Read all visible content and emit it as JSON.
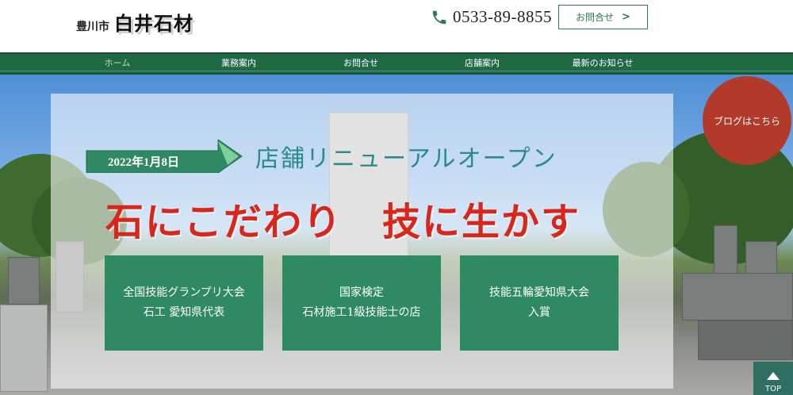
{
  "header": {
    "city": "豊川市",
    "company": "白井石材",
    "phone": "0533-89-8855",
    "contact_label": "お問合せ"
  },
  "nav": {
    "items": [
      {
        "label": "ホーム",
        "active": true
      },
      {
        "label": "業務案内"
      },
      {
        "label": "お問合せ"
      },
      {
        "label": "店舗案内"
      },
      {
        "label": "最新のお知らせ"
      }
    ]
  },
  "hero": {
    "date": "2022年1月8日",
    "subtitle": "店舗リニューアルオープン",
    "headline": "石にこだわり　技に生かす",
    "boxes": [
      {
        "line1": "全国技能グランプリ大会",
        "line2": "石工 愛知県代表"
      },
      {
        "line1": "国家検定",
        "line2": "石材施工1級技能士の店"
      },
      {
        "line1": "技能五輪愛知県大会",
        "line2": "入賞"
      }
    ]
  },
  "blog_label": "ブログはこちら",
  "top_label": "TOP",
  "colors": {
    "nav_green": "#1f6a44",
    "box_green": "#2f8a64",
    "headline_red": "#d8261b",
    "blog_red": "#b13a2a",
    "subtitle_teal": "#2a8a8c"
  }
}
